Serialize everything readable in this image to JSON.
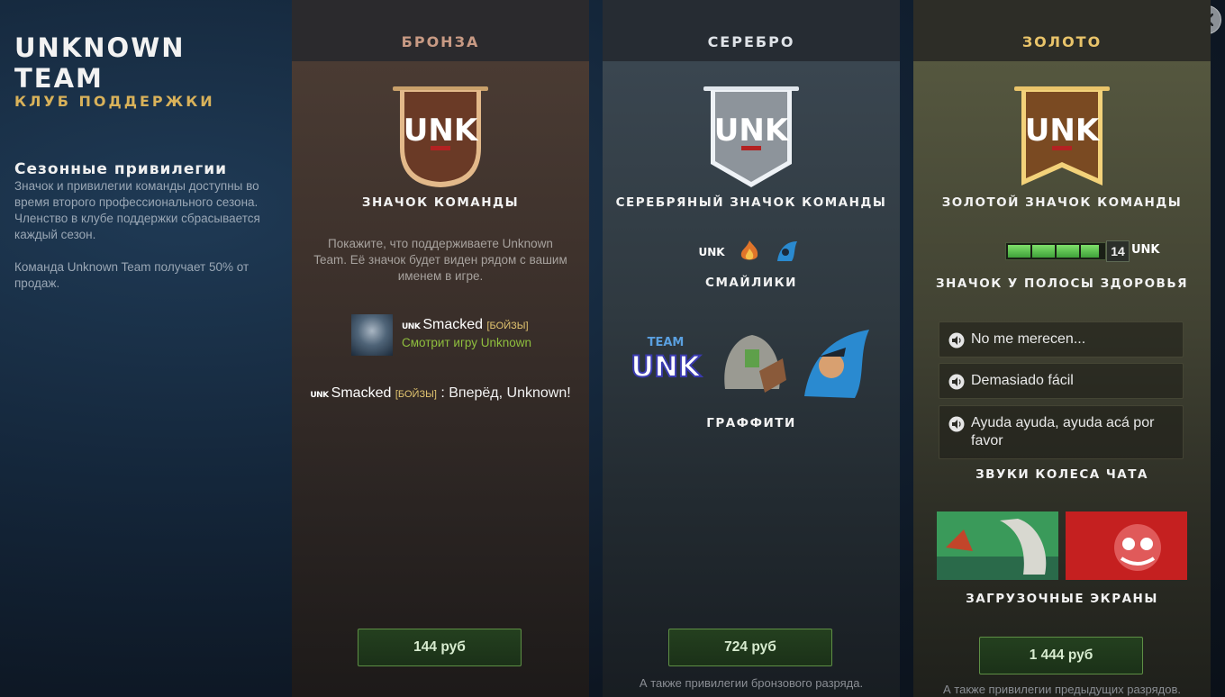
{
  "sidebar": {
    "team_name": "UNKNOWN TEAM",
    "club_title": "КЛУБ ПОДДЕРЖКИ",
    "season_title": "Сезонные привилегии",
    "season_description": "Значок и привилегии команды доступны во время второго профессионального сезона. Членство в клубе поддержки сбрасывается каждый сезон.",
    "revenue_note": "Команда Unknown Team получает 50% от продаж."
  },
  "close_icon": "close-icon",
  "tiers": {
    "bronze": {
      "name": "БРОНЗА",
      "badge_label": "ЗНАЧОК КОМАНДЫ",
      "badge_text": "UNK",
      "description": "Покажите, что поддерживаете Unknown Team. Её значок будет виден рядом с вашим именем в игре.",
      "player": {
        "tag": "UNK",
        "name": "Smacked",
        "rank": "[БОЙЗЫ]",
        "status": "Смотрит игру Unknown"
      },
      "chat": {
        "tag": "UNK",
        "name": "Smacked",
        "rank": "[БОЙЗЫ]",
        "separator": ":",
        "message": "Вперёд, Unknown!"
      },
      "price": "144 руб",
      "color": "#c89a84"
    },
    "silver": {
      "name": "СЕРЕБРО",
      "badge_label": "СЕРЕБРЯНЫЙ ЗНАЧОК КОМАНДЫ",
      "badge_text": "UNK",
      "emotes_label": "СМАЙЛИКИ",
      "graffiti_label": "ГРАФФИТИ",
      "graffiti_team_text": "TEAM",
      "graffiti_unk_text": "UNK",
      "price": "724 руб",
      "footnote": "А также привилегии бронзового разряда.",
      "color": "#dfe3e8"
    },
    "gold": {
      "name": "ЗОЛОТО",
      "badge_label": "ЗОЛОТОЙ ЗНАЧОК КОМАНДЫ",
      "badge_text": "UNK",
      "health_bar_label": "ЗНАЧОК У ПОЛОСЫ ЗДОРОВЬЯ",
      "health_bar_fill": 0.95,
      "hero_level": "14",
      "hp_tag": "UNK",
      "sounds": [
        "No me merecen...",
        "Demasiado fácil",
        "Ayuda ayuda, ayuda acá por favor"
      ],
      "sounds_label": "ЗВУКИ КОЛЕСА ЧАТА",
      "loading_screens_label": "ЗАГРУЗОЧНЫЕ ЭКРАНЫ",
      "price": "1 444 руб",
      "footnote": "А также привилегии предыдущих разрядов.",
      "color": "#e9c46a"
    }
  },
  "colors": {
    "bronze_banner": "#6a3a26",
    "silver_banner": "#8d949b",
    "gold_banner": "#7a4a22",
    "price_border": "#5e8f45",
    "watching_text": "#8fbf3e"
  }
}
